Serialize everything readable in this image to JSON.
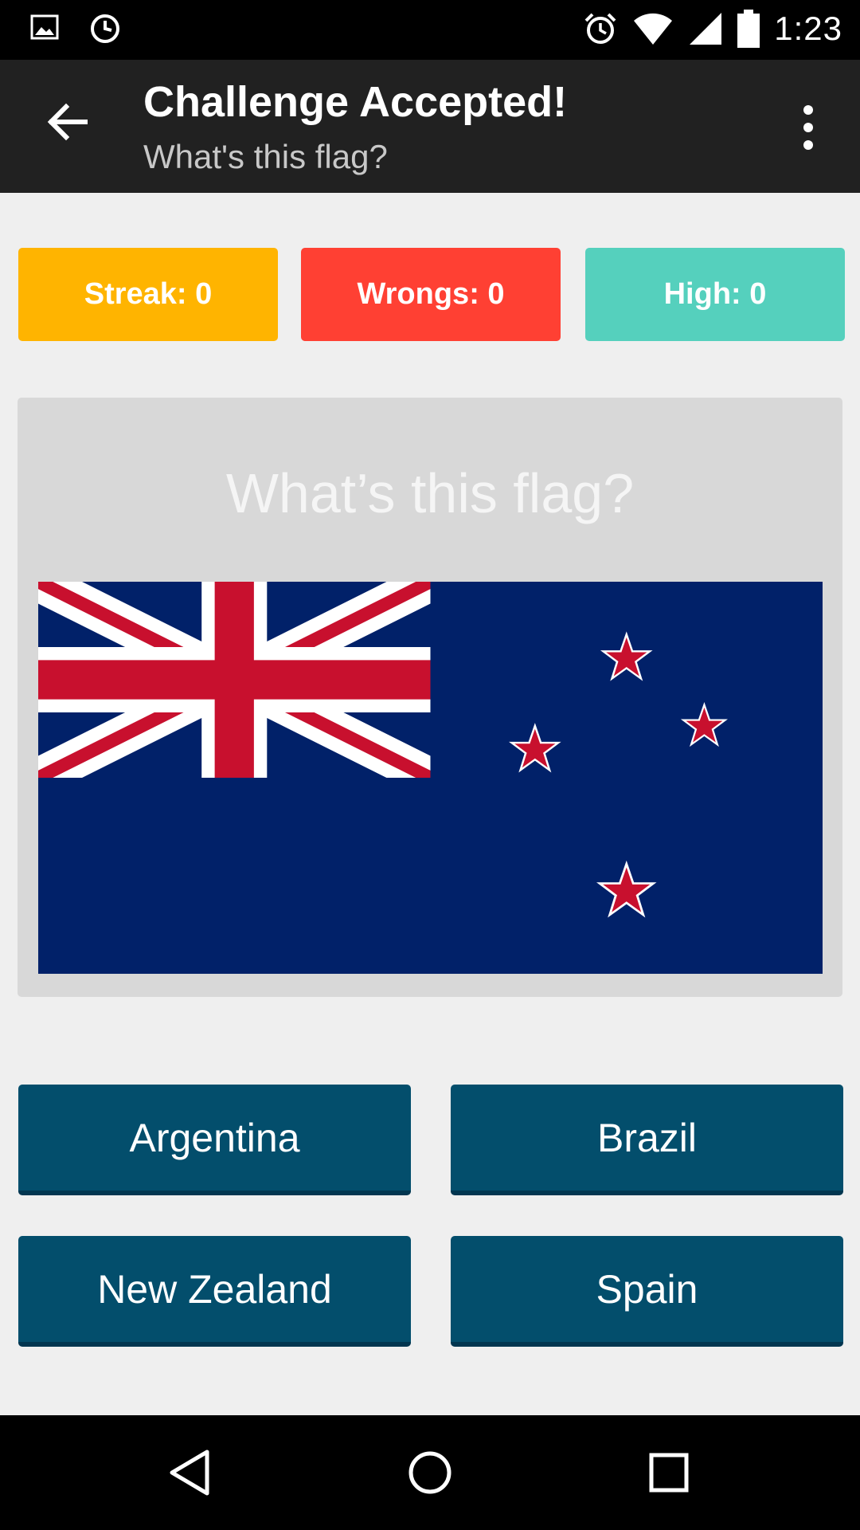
{
  "status_bar": {
    "time": "1:23",
    "icons_left": [
      "image-icon",
      "clock-icon"
    ],
    "icons_right": [
      "alarm-icon",
      "wifi-icon",
      "signal-icon",
      "battery-icon"
    ]
  },
  "app_bar": {
    "title": "Challenge Accepted!",
    "subtitle": "What's this flag?"
  },
  "stats": {
    "streak": "Streak: 0",
    "wrongs": "Wrongs: 0",
    "high": "High: 0"
  },
  "card": {
    "question": "What’s this flag?"
  },
  "answers": [
    "Argentina",
    "Brazil",
    "New Zealand",
    "Spain"
  ],
  "colors": {
    "appbar": "#212121",
    "streak": "#ffb400",
    "wrongs": "#ff4033",
    "high": "#55d0bd",
    "answer": "#034e6c",
    "flag_blue": "#012169",
    "flag_red": "#c8102e"
  }
}
